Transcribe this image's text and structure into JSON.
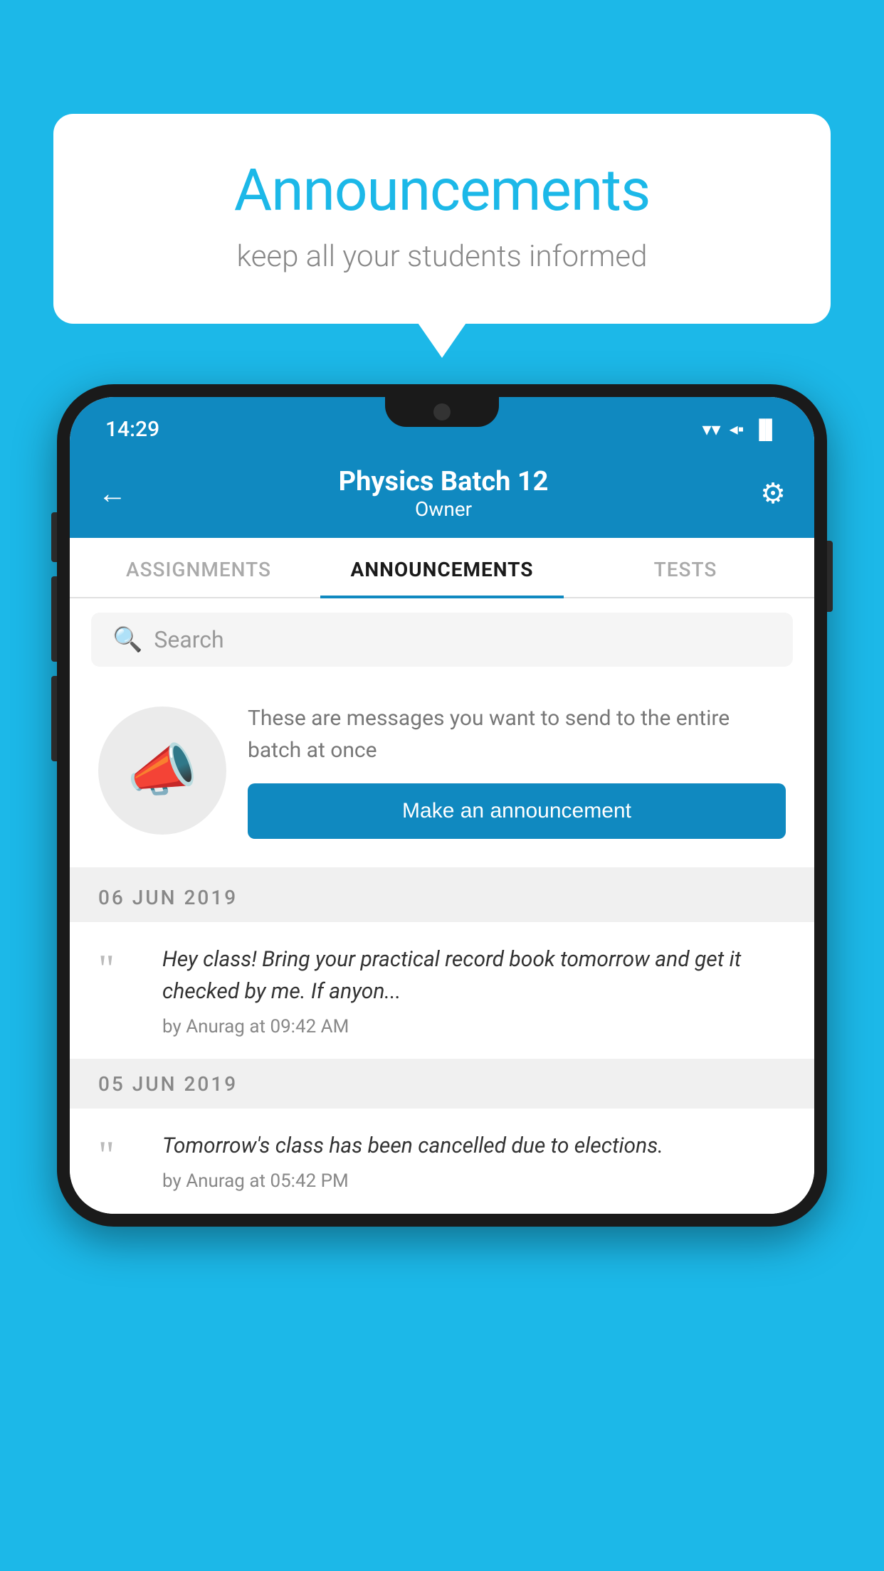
{
  "background_color": "#1cb8e8",
  "speech_bubble": {
    "title": "Announcements",
    "subtitle": "keep all your students informed"
  },
  "status_bar": {
    "time": "14:29",
    "wifi": "▼",
    "signal": "◀",
    "battery": "▐"
  },
  "header": {
    "back_label": "←",
    "batch_name": "Physics Batch 12",
    "role": "Owner",
    "settings_label": "⚙"
  },
  "tabs": [
    {
      "label": "ASSIGNMENTS",
      "active": false
    },
    {
      "label": "ANNOUNCEMENTS",
      "active": true
    },
    {
      "label": "TESTS",
      "active": false
    }
  ],
  "search": {
    "placeholder": "Search"
  },
  "promo_card": {
    "description_text": "These are messages you want to send to the entire batch at once",
    "button_label": "Make an announcement"
  },
  "announcements": [
    {
      "date": "06  JUN  2019",
      "text": "Hey class! Bring your practical record book tomorrow and get it checked by me. If anyon...",
      "meta": "by Anurag at 09:42 AM"
    },
    {
      "date": "05  JUN  2019",
      "text": "Tomorrow's class has been cancelled due to elections.",
      "meta": "by Anurag at 05:42 PM"
    }
  ]
}
